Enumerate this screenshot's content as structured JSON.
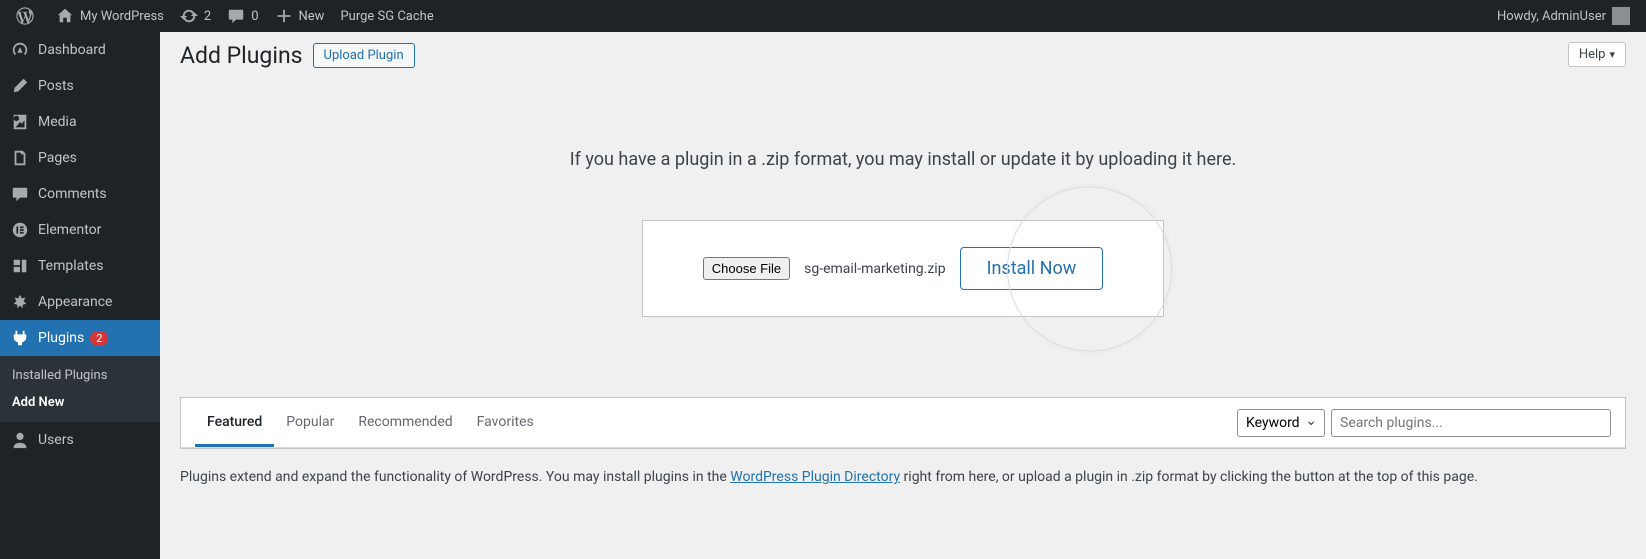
{
  "adminbar": {
    "site_name": "My WordPress",
    "updates_count": "2",
    "comments_count": "0",
    "new_label": "New",
    "purge_label": "Purge SG Cache",
    "howdy": "Howdy, AdminUser"
  },
  "sidebar": {
    "dashboard": "Dashboard",
    "posts": "Posts",
    "media": "Media",
    "pages": "Pages",
    "comments": "Comments",
    "elementor": "Elementor",
    "templates": "Templates",
    "appearance": "Appearance",
    "plugins": "Plugins",
    "plugins_count": "2",
    "installed_plugins": "Installed Plugins",
    "add_new": "Add New",
    "users": "Users"
  },
  "page": {
    "help": "Help",
    "title": "Add Plugins",
    "upload_plugin": "Upload Plugin"
  },
  "upload": {
    "message": "If you have a plugin in a .zip format, you may install or update it by uploading it here.",
    "choose_file": "Choose File",
    "file_name": "sg-email-marketing.zip",
    "install_now": "Install Now"
  },
  "filter": {
    "tabs": {
      "featured": "Featured",
      "popular": "Popular",
      "recommended": "Recommended",
      "favorites": "Favorites"
    },
    "search_type": "Keyword",
    "search_placeholder": "Search plugins..."
  },
  "description": {
    "pre": "Plugins extend and expand the functionality of WordPress. You may install plugins in the ",
    "link": "WordPress Plugin Directory",
    "post": " right from here, or upload a plugin in .zip format by clicking the button at the top of this page."
  }
}
